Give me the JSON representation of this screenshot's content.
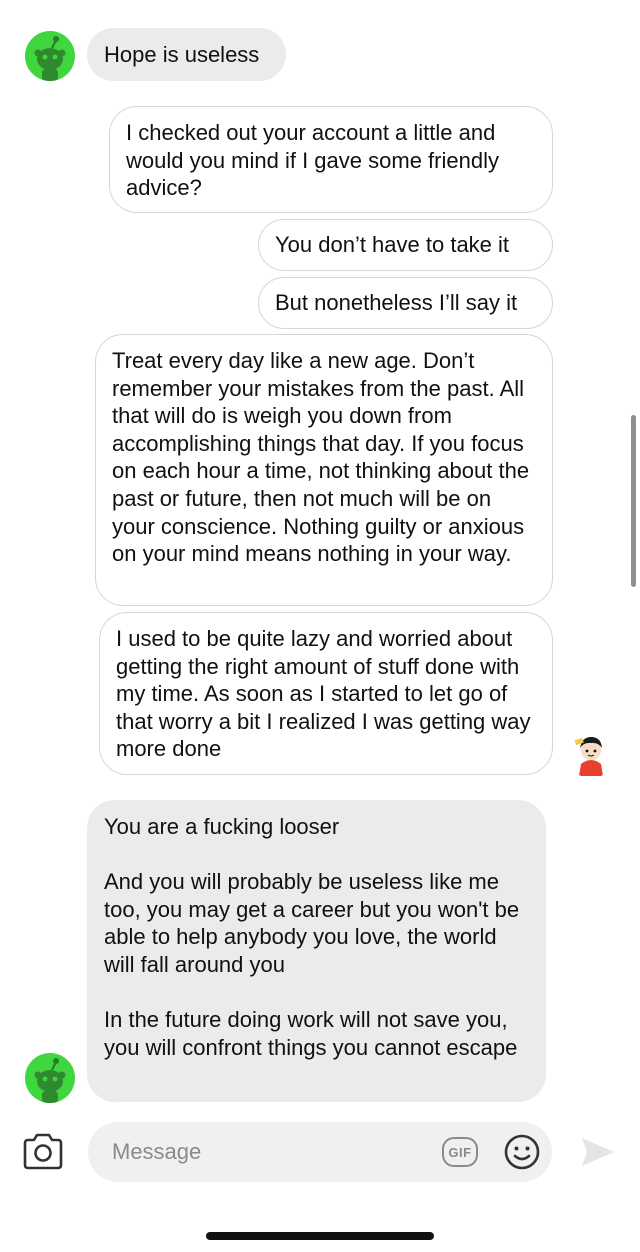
{
  "messages": [
    {
      "sender": "other",
      "paragraphs": [
        "Hope is useless"
      ]
    },
    {
      "sender": "me",
      "paragraphs": [
        "I checked out your account a little and would you mind if I gave some friendly advice?"
      ]
    },
    {
      "sender": "me",
      "paragraphs": [
        "You don’t  have to take it"
      ]
    },
    {
      "sender": "me",
      "paragraphs": [
        "But nonetheless I’ll say it"
      ]
    },
    {
      "sender": "me",
      "paragraphs": [
        "Treat every day like a new age. Don’t remember your mistakes from the past. All that will do is weigh you down from accomplishing things that day. If you focus on each hour a time, not thinking about the past or future,  then not much will be on your conscience. Nothing guilty or anxious on your mind means nothing in your way."
      ]
    },
    {
      "sender": "me",
      "paragraphs": [
        "I used to be quite lazy and worried about getting the right amount of stuff done with my time. As soon as I started to let go of that worry a bit I realized I was getting way more done"
      ]
    },
    {
      "sender": "other",
      "paragraphs": [
        "You are a fucking looser",
        "And you will probably be useless like me too, you may get a career but you won't be able to help anybody you love, the world will fall around you",
        "In the future doing work will not save you, you will confront things you cannot escape"
      ]
    }
  ],
  "composer": {
    "placeholder": "Message",
    "gif_label": "GIF",
    "camera_icon": "camera-icon",
    "emoji_icon": "smiley-icon",
    "send_icon": "send-arrow-icon"
  },
  "colors": {
    "incoming_bubble": "#ebebec",
    "outgoing_border": "#d6d6d8",
    "avatar_green": "#3fd63f",
    "muted_icon": "#8a8a8e"
  }
}
